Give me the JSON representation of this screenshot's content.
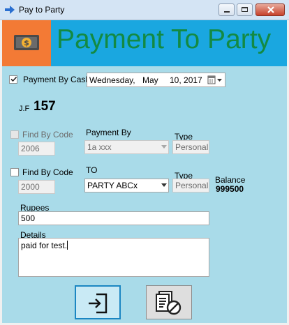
{
  "window": {
    "title": "Pay to Party",
    "icons": [
      "arrow-right-icon",
      "minimize-icon",
      "maximize-icon",
      "close-icon"
    ]
  },
  "header": {
    "title": "Payment To Party",
    "logo_icon": "money-icon",
    "colors": {
      "band": "#1aa7e0",
      "logo_bg": "#f37a35",
      "title": "#138a43"
    }
  },
  "payment_by_cash": {
    "label": "Payment By Cash",
    "checked": true,
    "date": {
      "weekday": "Wednesday,",
      "month": "May",
      "day_year": "10, 2017"
    }
  },
  "jf": {
    "label": "J.F",
    "value": "157"
  },
  "from_section": {
    "find_by_code_label": "Find By Code",
    "code": "2006",
    "payment_by_label": "Payment By",
    "payment_by_value": "1a xxx",
    "type_label": "Type",
    "type_value": "Personal"
  },
  "to_section": {
    "find_by_code_label": "Find By Code",
    "code": "2000",
    "to_label": "TO",
    "to_value": "PARTY ABCx",
    "type_label": "Type",
    "type_value": "Personal",
    "balance_label": "Balance",
    "balance_value": "999500"
  },
  "rupees": {
    "label": "Rupees",
    "value": "500"
  },
  "details": {
    "label": "Details",
    "value": "paid for test."
  },
  "actions": {
    "icons": [
      "login-icon",
      "cancel-document-icon"
    ]
  },
  "colors": {
    "client_bg": "#a9dbe9",
    "focused_border": "#1b86c2"
  }
}
